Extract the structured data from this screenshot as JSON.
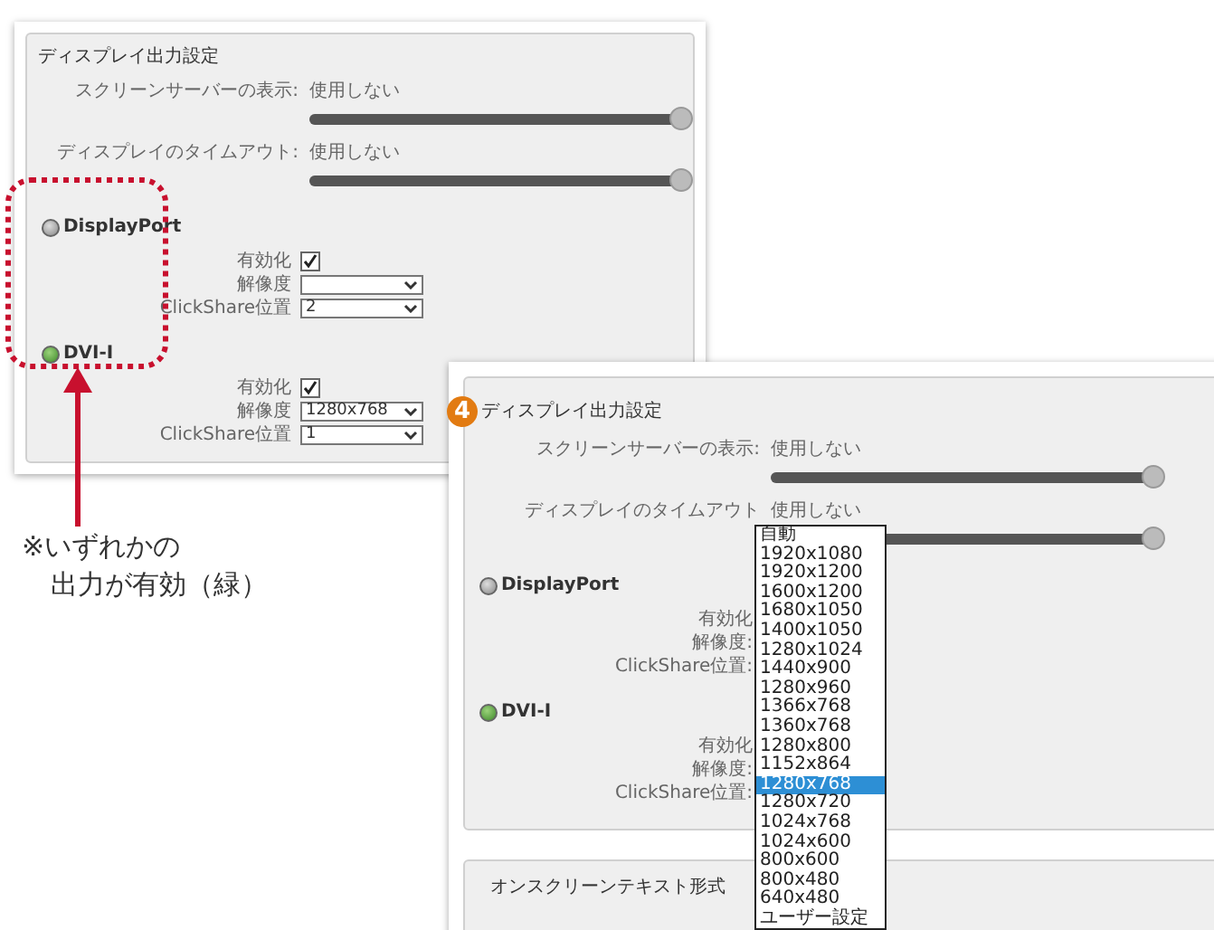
{
  "screenshot_1": {
    "title": "ディスプレイ出力設定",
    "sliders": [
      {
        "label": "スクリーンサーバーの表示:",
        "value": "使用しない",
        "level": 1
      },
      {
        "label": "ディスプレイのタイムアウト:",
        "value": "使用しない",
        "level": 1
      }
    ],
    "outputs": [
      {
        "name": "DisplayPort",
        "active": false,
        "fields": [
          {
            "kind": "checkbox",
            "label": "有効化",
            "checked": true
          },
          {
            "kind": "select",
            "label": "解像度"
          },
          {
            "kind": "select",
            "label": "ClickShare位置",
            "value": "2"
          }
        ]
      },
      {
        "name": "DVI-I",
        "active": true,
        "fields": [
          {
            "kind": "checkbox",
            "label": "有効化",
            "checked": true
          },
          {
            "kind": "select",
            "label": "解像度",
            "value": "1280x768"
          },
          {
            "kind": "select",
            "label": "ClickShare位置",
            "value": "1"
          }
        ]
      }
    ]
  },
  "screenshot_2": {
    "badge": "4",
    "title": "ディスプレイ出力設定",
    "sliders": [
      {
        "label": "スクリーンサーバーの表示:",
        "value": "使用しない",
        "level": 1
      },
      {
        "label": "ディスプレイのタイムアウト",
        "value": "使用しない",
        "level": 1
      }
    ],
    "outputs": [
      {
        "name": "DisplayPort",
        "active": false,
        "fields": [
          {
            "label": "有効化"
          },
          {
            "label": "解像度:"
          },
          {
            "label": "ClickShare位置:"
          }
        ]
      },
      {
        "name": "DVI-I",
        "active": true,
        "fields": [
          {
            "label": "有効化"
          },
          {
            "label": "解像度:"
          },
          {
            "label": "ClickShare位置:"
          }
        ]
      }
    ],
    "dropdown": {
      "items": [
        {
          "label": "自動",
          "selected": false
        },
        {
          "label": "1920x1080",
          "selected": false
        },
        {
          "label": "1920x1200",
          "selected": false
        },
        {
          "label": "1600x1200",
          "selected": false
        },
        {
          "label": "1680x1050",
          "selected": false
        },
        {
          "label": "1400x1050",
          "selected": false
        },
        {
          "label": "1280x1024",
          "selected": false
        },
        {
          "label": "1440x900",
          "selected": false
        },
        {
          "label": "1280x960",
          "selected": false
        },
        {
          "label": "1366x768",
          "selected": false
        },
        {
          "label": "1360x768",
          "selected": false
        },
        {
          "label": "1280x800",
          "selected": false
        },
        {
          "label": "1152x864",
          "selected": false
        },
        {
          "label": "1280x768",
          "selected": true
        },
        {
          "label": "1280x720",
          "selected": false
        },
        {
          "label": "1024x768",
          "selected": false
        },
        {
          "label": "1024x600",
          "selected": false
        },
        {
          "label": "800x600",
          "selected": false
        },
        {
          "label": "800x480",
          "selected": false
        },
        {
          "label": "640x480",
          "selected": false
        },
        {
          "label": "ユーザー設定",
          "selected": false
        }
      ]
    },
    "section_2": {
      "title": "オンスクリーンテキスト形式"
    }
  },
  "annotation": {
    "lines": [
      "※いずれかの",
      "出力が有効（緑）"
    ]
  }
}
